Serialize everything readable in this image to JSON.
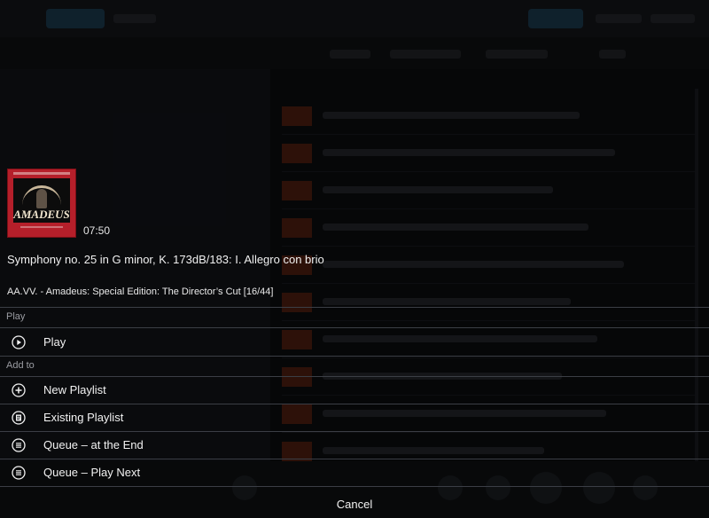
{
  "track": {
    "duration": "07:50",
    "title": "Symphony no. 25 in G minor, K. 173dB/183: I. Allegro con brio",
    "album_line": "AA.VV. - Amadeus: Special Edition: The Director’s Cut [16/44]",
    "album_art": {
      "logo_text": "AMADEUS",
      "background": "#b51f2a"
    }
  },
  "sections": {
    "play_label": "Play",
    "add_to_label": "Add to"
  },
  "actions": {
    "play": {
      "label": "Play",
      "icon": "play-circle-icon"
    },
    "new_playlist": {
      "label": "New Playlist",
      "icon": "plus-circle-icon"
    },
    "existing_playlist": {
      "label": "Existing Playlist",
      "icon": "playlist-icon"
    },
    "queue_end": {
      "label": "Queue – at the End",
      "icon": "queue-icon"
    },
    "queue_next": {
      "label": "Queue – Play Next",
      "icon": "queue-icon"
    }
  },
  "cancel_label": "Cancel",
  "colors": {
    "accent": "#2b6f9a",
    "separator": "#3b3e45",
    "muted_text": "#9a9ca2"
  }
}
